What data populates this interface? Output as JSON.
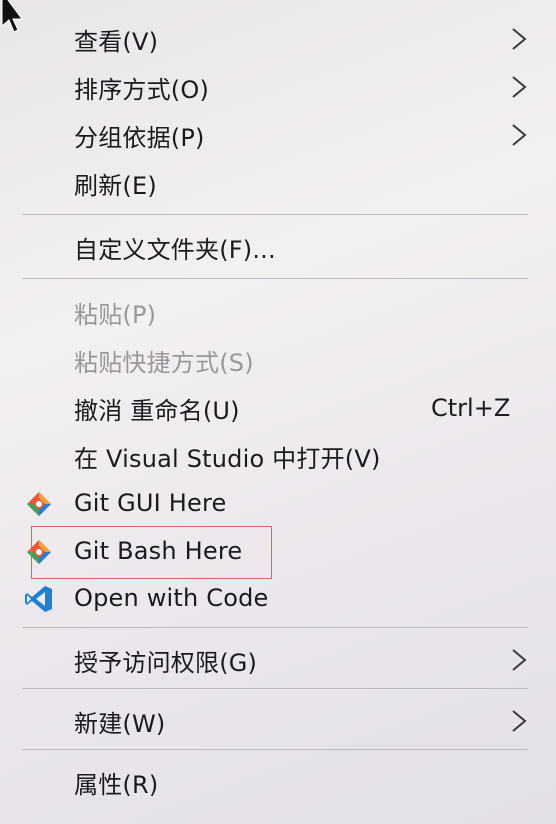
{
  "context_menu": {
    "items": [
      {
        "label": "查看(V)",
        "submenu": true
      },
      {
        "label": "排序方式(O)",
        "submenu": true
      },
      {
        "label": "分组依据(P)",
        "submenu": true
      },
      {
        "label": "刷新(E)"
      },
      {
        "label": "自定义文件夹(F)..."
      },
      {
        "label": "粘贴(P)",
        "disabled": true
      },
      {
        "label": "粘贴快捷方式(S)",
        "disabled": true
      },
      {
        "label": "撤消 重命名(U)",
        "shortcut": "Ctrl+Z"
      },
      {
        "label": "在 Visual Studio 中打开(V)"
      },
      {
        "label": "Git GUI Here",
        "icon": "git-gui-icon"
      },
      {
        "label": "Git Bash Here",
        "icon": "git-bash-icon",
        "highlighted": true
      },
      {
        "label": "Open with Code",
        "icon": "vscode-icon"
      },
      {
        "label": "授予访问权限(G)",
        "submenu": true
      },
      {
        "label": "新建(W)",
        "submenu": true
      },
      {
        "label": "属性(R)"
      }
    ]
  },
  "colors": {
    "text": "#1b1b1f",
    "disabled_text": "#9a979c",
    "separator": "#bdb9c0",
    "highlight_border": "#e0625f",
    "vscode_blue": "#1f7fd1"
  }
}
